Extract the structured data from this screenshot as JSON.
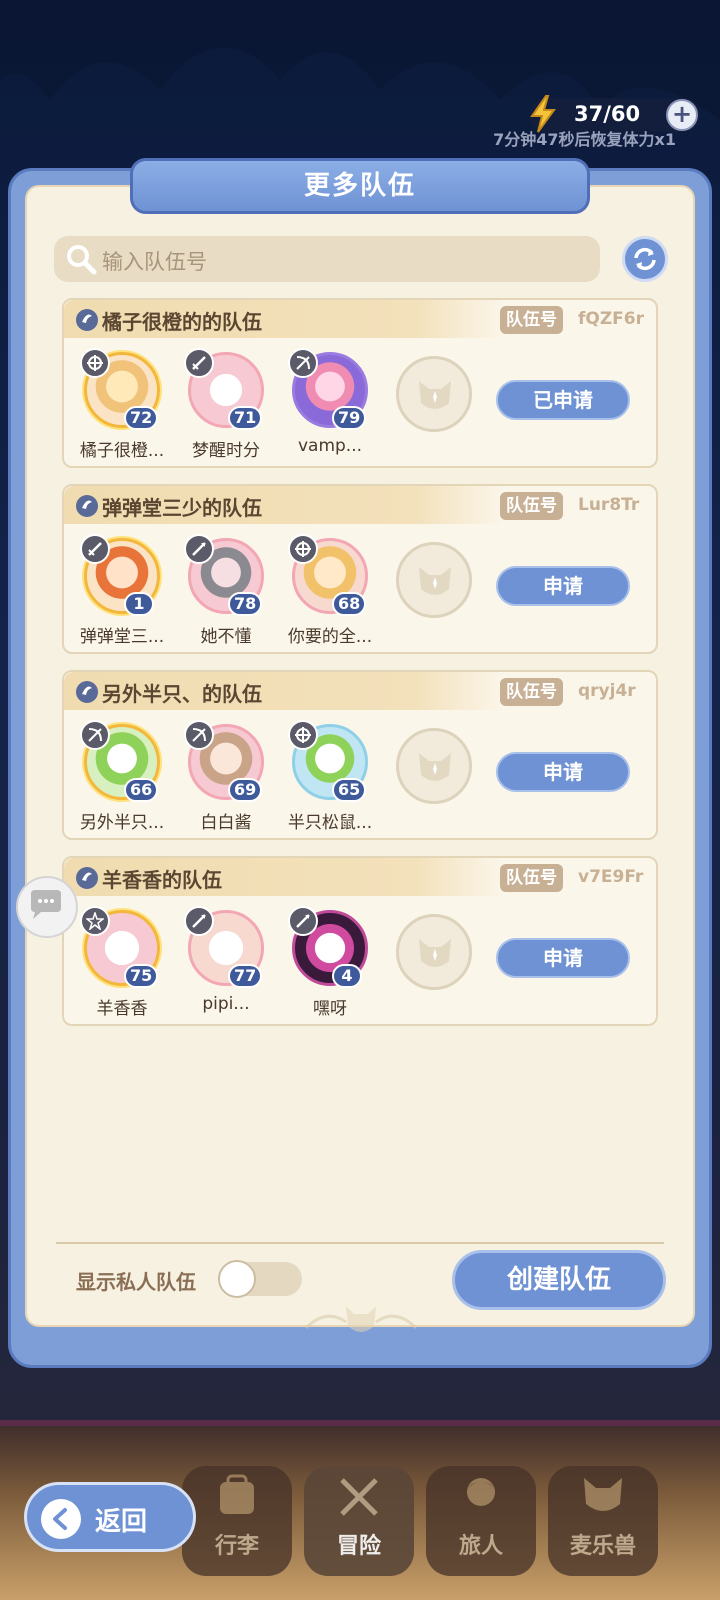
{
  "stamina": {
    "value": "37/60",
    "plus": "+",
    "recover_text": "7分钟47秒后恢复体力x1"
  },
  "panel": {
    "title": "更多队伍",
    "search_placeholder": "输入队伍号",
    "id_label": "队伍号",
    "teams": [
      {
        "name": "橘子很橙的的队伍",
        "id": "fQZF6r",
        "button": "已申请",
        "members": [
          {
            "name": "橘子很橙...",
            "level": "72"
          },
          {
            "name": "梦醒时分",
            "level": "71"
          },
          {
            "name": "vamp...",
            "level": "79"
          }
        ]
      },
      {
        "name": "弹弹堂三少的队伍",
        "id": "Lur8Tr",
        "button": "申请",
        "members": [
          {
            "name": "弹弹堂三...",
            "level": "1"
          },
          {
            "name": "她不懂",
            "level": "78"
          },
          {
            "name": "你要的全...",
            "level": "68"
          }
        ]
      },
      {
        "name": "另外半只、的队伍",
        "id": "qryj4r",
        "button": "申请",
        "members": [
          {
            "name": "另外半只...",
            "level": "66"
          },
          {
            "name": "白白酱",
            "level": "69"
          },
          {
            "name": "半只松鼠...",
            "level": "65"
          }
        ]
      },
      {
        "name": "羊香香的队伍",
        "id": "v7E9Fr",
        "button": "申请",
        "members": [
          {
            "name": "羊香香",
            "level": "75"
          },
          {
            "name": "pipi...",
            "level": "77"
          },
          {
            "name": "嘿呀",
            "level": "4"
          }
        ]
      }
    ],
    "show_private_label": "显示私人队伍",
    "show_private_on": false,
    "create_button": "创建队伍"
  },
  "nav": {
    "back": "返回",
    "items": [
      "行李",
      "冒险",
      "旅人",
      "麦乐兽"
    ],
    "active": "冒险"
  },
  "colors": {
    "accent": "#6f92d4",
    "panel_bg": "#f7f1e2",
    "level_badge": "#3e5a9a"
  }
}
